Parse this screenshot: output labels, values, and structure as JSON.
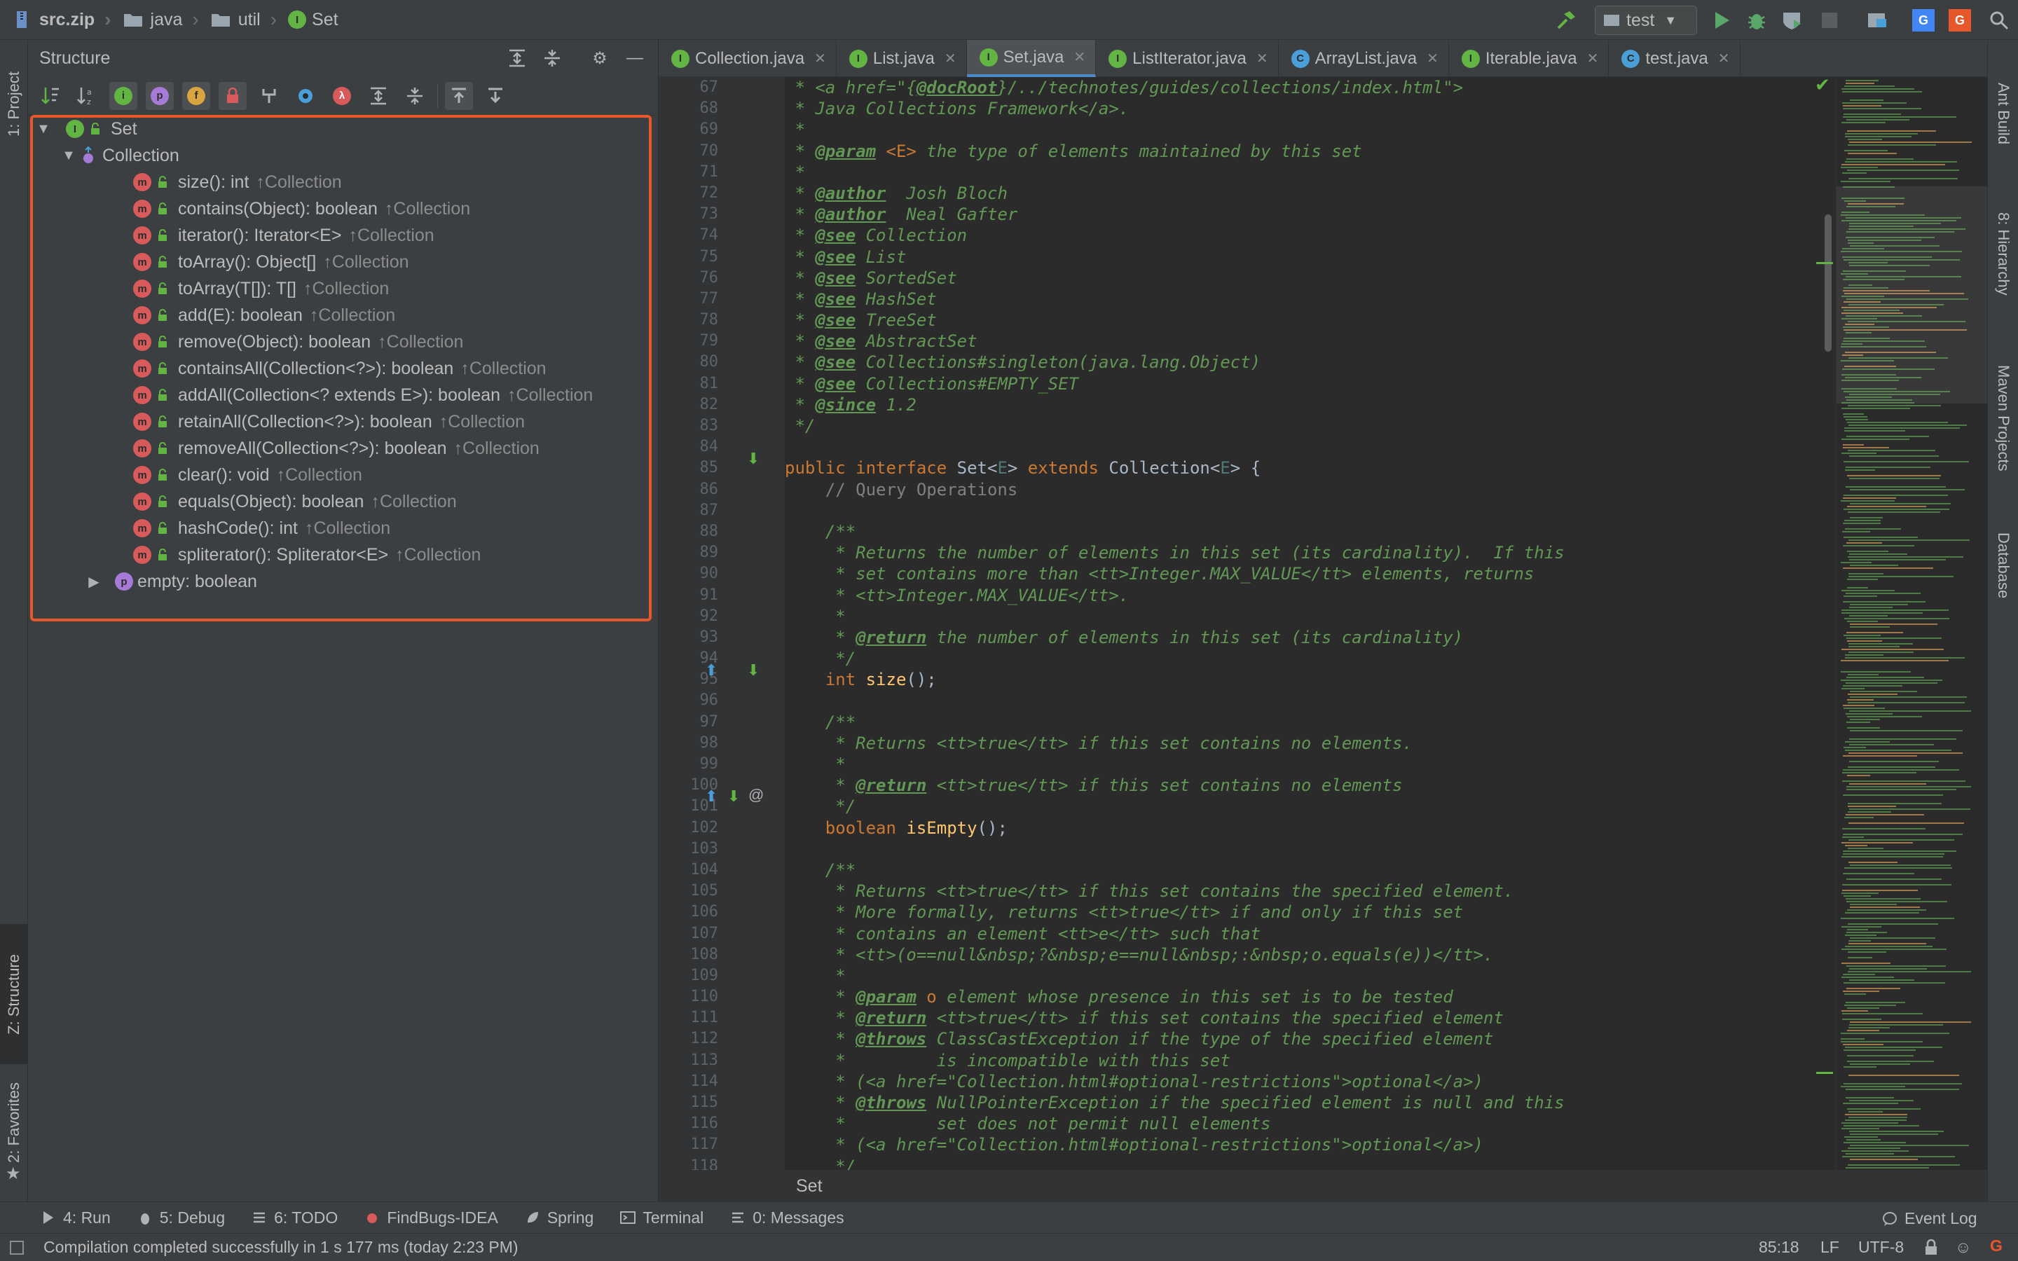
{
  "navbar": {
    "breadcrumbs": [
      "src.zip",
      "java",
      "util",
      "Set"
    ],
    "run_config": "test"
  },
  "left_strip": {
    "project": "1: Project",
    "structure": "Z: Structure",
    "favorites": "2: Favorites"
  },
  "right_strip": {
    "ant": "Ant Build",
    "hierarchy": "8: Hierarchy",
    "maven": "Maven Projects",
    "database": "Database"
  },
  "structure": {
    "title": "Structure",
    "root": "Set",
    "group": "Collection",
    "methods": [
      {
        "sig": "size(): int",
        "from": "↑Collection"
      },
      {
        "sig": "contains(Object): boolean",
        "from": "↑Collection"
      },
      {
        "sig": "iterator(): Iterator<E>",
        "from": "↑Collection"
      },
      {
        "sig": "toArray(): Object[]",
        "from": "↑Collection"
      },
      {
        "sig": "toArray(T[]): T[]",
        "from": "↑Collection"
      },
      {
        "sig": "add(E): boolean",
        "from": "↑Collection"
      },
      {
        "sig": "remove(Object): boolean",
        "from": "↑Collection"
      },
      {
        "sig": "containsAll(Collection<?>): boolean",
        "from": "↑Collection"
      },
      {
        "sig": "addAll(Collection<? extends E>): boolean",
        "from": "↑Collection"
      },
      {
        "sig": "retainAll(Collection<?>): boolean",
        "from": "↑Collection"
      },
      {
        "sig": "removeAll(Collection<?>): boolean",
        "from": "↑Collection"
      },
      {
        "sig": "clear(): void",
        "from": "↑Collection"
      },
      {
        "sig": "equals(Object): boolean",
        "from": "↑Collection"
      },
      {
        "sig": "hashCode(): int",
        "from": "↑Collection"
      },
      {
        "sig": "spliterator(): Spliterator<E>",
        "from": "↑Collection"
      }
    ],
    "property": "empty: boolean"
  },
  "tabs": [
    {
      "label": "Collection.java",
      "icon": "I",
      "color": "#62b543"
    },
    {
      "label": "List.java",
      "icon": "I",
      "color": "#62b543"
    },
    {
      "label": "Set.java",
      "icon": "I",
      "color": "#62b543"
    },
    {
      "label": "ListIterator.java",
      "icon": "I",
      "color": "#62b543"
    },
    {
      "label": "ArrayList.java",
      "icon": "C",
      "color": "#4a9fd8"
    },
    {
      "label": "Iterable.java",
      "icon": "I",
      "color": "#62b543"
    },
    {
      "label": "test.java",
      "icon": "C",
      "color": "#4a9fd8"
    }
  ],
  "editor": {
    "first_line": 67,
    "last_line": 118,
    "breadcrumb": "Set"
  },
  "code": [
    [
      [
        "cmt",
        " * <a href=\"{"
      ],
      [
        "tag",
        "@docRoot"
      ],
      [
        "cmt",
        "}/../technotes/guides/collections/index.html\">"
      ]
    ],
    [
      [
        "cmt",
        " * Java Collections Framework</a>."
      ]
    ],
    [
      [
        "cmt",
        " *"
      ]
    ],
    [
      [
        "cmt",
        " * "
      ],
      [
        "tag",
        "@param"
      ],
      [
        "kw",
        " <E>"
      ],
      [
        "cmt",
        " the type of elements maintained by this set"
      ]
    ],
    [
      [
        "cmt",
        " *"
      ]
    ],
    [
      [
        "cmt",
        " * "
      ],
      [
        "tag",
        "@author"
      ],
      [
        "cmt",
        "  Josh Bloch"
      ]
    ],
    [
      [
        "cmt",
        " * "
      ],
      [
        "tag",
        "@author"
      ],
      [
        "cmt",
        "  Neal Gafter"
      ]
    ],
    [
      [
        "cmt",
        " * "
      ],
      [
        "tag",
        "@see"
      ],
      [
        "cmt",
        " Collection"
      ]
    ],
    [
      [
        "cmt",
        " * "
      ],
      [
        "tag",
        "@see"
      ],
      [
        "cmt",
        " List"
      ]
    ],
    [
      [
        "cmt",
        " * "
      ],
      [
        "tag",
        "@see"
      ],
      [
        "cmt",
        " SortedSet"
      ]
    ],
    [
      [
        "cmt",
        " * "
      ],
      [
        "tag",
        "@see"
      ],
      [
        "cmt",
        " HashSet"
      ]
    ],
    [
      [
        "cmt",
        " * "
      ],
      [
        "tag",
        "@see"
      ],
      [
        "cmt",
        " TreeSet"
      ]
    ],
    [
      [
        "cmt",
        " * "
      ],
      [
        "tag",
        "@see"
      ],
      [
        "cmt",
        " AbstractSet"
      ]
    ],
    [
      [
        "cmt",
        " * "
      ],
      [
        "tag",
        "@see"
      ],
      [
        "cmt",
        " Collections#singleton(java.lang.Object)"
      ]
    ],
    [
      [
        "cmt",
        " * "
      ],
      [
        "tag",
        "@see"
      ],
      [
        "cmt",
        " Collections#EMPTY_SET"
      ]
    ],
    [
      [
        "cmt",
        " * "
      ],
      [
        "tag",
        "@since"
      ],
      [
        "cmt",
        " 1.2"
      ]
    ],
    [
      [
        "cmt",
        " */"
      ]
    ],
    [
      [
        "plain",
        ""
      ]
    ],
    [
      [
        "kw",
        "public interface "
      ],
      [
        "plain",
        "Set<"
      ],
      [
        "tp",
        "E"
      ],
      [
        "plain",
        "> "
      ],
      [
        "kw",
        "extends "
      ],
      [
        "plain",
        "Collection<"
      ],
      [
        "tp",
        "E"
      ],
      [
        "plain",
        "> {"
      ]
    ],
    [
      [
        "lc",
        "    // Query Operations"
      ]
    ],
    [
      [
        "plain",
        ""
      ]
    ],
    [
      [
        "cmt",
        "    /**"
      ]
    ],
    [
      [
        "cmt",
        "     * Returns the number of elements in this set (its cardinality).  If this"
      ]
    ],
    [
      [
        "cmt",
        "     * set contains more than <tt>Integer.MAX_VALUE</tt> elements, returns"
      ]
    ],
    [
      [
        "cmt",
        "     * <tt>Integer.MAX_VALUE</tt>."
      ]
    ],
    [
      [
        "cmt",
        "     *"
      ]
    ],
    [
      [
        "cmt",
        "     * "
      ],
      [
        "tag",
        "@return"
      ],
      [
        "cmt",
        " the number of elements in this set (its cardinality)"
      ]
    ],
    [
      [
        "cmt",
        "     */"
      ]
    ],
    [
      [
        "kw",
        "    int "
      ],
      [
        "fn",
        "size"
      ],
      [
        "plain",
        "();"
      ]
    ],
    [
      [
        "plain",
        ""
      ]
    ],
    [
      [
        "cmt",
        "    /**"
      ]
    ],
    [
      [
        "cmt",
        "     * Returns <tt>true</tt> if this set contains no elements."
      ]
    ],
    [
      [
        "cmt",
        "     *"
      ]
    ],
    [
      [
        "cmt",
        "     * "
      ],
      [
        "tag",
        "@return"
      ],
      [
        "cmt",
        " <tt>true</tt> if this set contains no elements"
      ]
    ],
    [
      [
        "cmt",
        "     */"
      ]
    ],
    [
      [
        "kw",
        "    boolean "
      ],
      [
        "fn",
        "isEmpty"
      ],
      [
        "plain",
        "();"
      ]
    ],
    [
      [
        "plain",
        ""
      ]
    ],
    [
      [
        "cmt",
        "    /**"
      ]
    ],
    [
      [
        "cmt",
        "     * Returns <tt>true</tt> if this set contains the specified element."
      ]
    ],
    [
      [
        "cmt",
        "     * More formally, returns <tt>true</tt> if and only if this set"
      ]
    ],
    [
      [
        "cmt",
        "     * contains an element <tt>e</tt> such that"
      ]
    ],
    [
      [
        "cmt",
        "     * <tt>(o==null&nbsp;?&nbsp;e==null&nbsp;:&nbsp;o.equals(e))</tt>."
      ]
    ],
    [
      [
        "cmt",
        "     *"
      ]
    ],
    [
      [
        "cmt",
        "     * "
      ],
      [
        "tag",
        "@param"
      ],
      [
        "kw",
        " o"
      ],
      [
        "cmt",
        " element whose presence in this set is to be tested"
      ]
    ],
    [
      [
        "cmt",
        "     * "
      ],
      [
        "tag",
        "@return"
      ],
      [
        "cmt",
        " <tt>true</tt> if this set contains the specified element"
      ]
    ],
    [
      [
        "cmt",
        "     * "
      ],
      [
        "tag",
        "@throws"
      ],
      [
        "cmt",
        " ClassCastException if the type of the specified element"
      ]
    ],
    [
      [
        "cmt",
        "     *         is incompatible with this set"
      ]
    ],
    [
      [
        "cmt",
        "     * (<a href=\"Collection.html#optional-restrictions\">optional</a>)"
      ]
    ],
    [
      [
        "cmt",
        "     * "
      ],
      [
        "tag",
        "@throws"
      ],
      [
        "cmt",
        " NullPointerException if the specified element is null and this"
      ]
    ],
    [
      [
        "cmt",
        "     *         set does not permit null elements"
      ]
    ],
    [
      [
        "cmt",
        "     * (<a href=\"Collection.html#optional-restrictions\">optional</a>)"
      ]
    ],
    [
      [
        "cmt",
        "     */"
      ]
    ]
  ],
  "tool_windows": [
    {
      "label": "4: Run",
      "icon": "run-icon"
    },
    {
      "label": "5: Debug",
      "icon": "debug-icon"
    },
    {
      "label": "6: TODO",
      "icon": "todo-icon"
    },
    {
      "label": "FindBugs-IDEA",
      "icon": "findbugs-icon"
    },
    {
      "label": "Spring",
      "icon": "spring-icon"
    },
    {
      "label": "Terminal",
      "icon": "terminal-icon"
    },
    {
      "label": "0: Messages",
      "icon": "messages-icon"
    }
  ],
  "event_log": "Event Log",
  "status": {
    "message": "Compilation completed successfully in 1 s 177 ms (today 2:23 PM)",
    "position": "85:18",
    "line_sep": "LF",
    "encoding": "UTF-8"
  },
  "colors": {
    "highlight": "#e8572a",
    "interface_icon": "#62b543",
    "class_icon": "#4a9fd8",
    "method_icon": "#d85a5a",
    "property_icon": "#a77ad8"
  }
}
